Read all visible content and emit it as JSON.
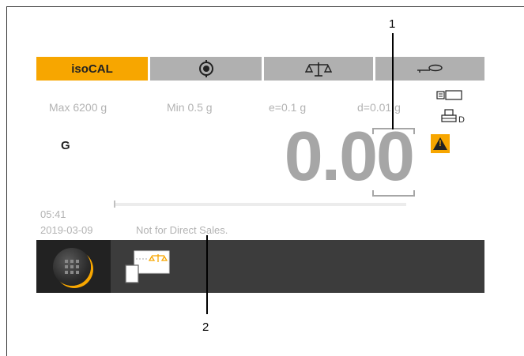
{
  "tabs": {
    "calibration_label": "isoCAL",
    "target_icon": "target-icon",
    "scale_icon": "balance-scale-icon",
    "key_icon": "key-icon"
  },
  "specs": {
    "max": "Max 6200 g",
    "min": "Min 0.5 g",
    "e": "e=0.1 g",
    "d": "d=0.01 g"
  },
  "weighing": {
    "mode": "G",
    "value": "0.00"
  },
  "status_icons": [
    "card-icon",
    "printer-icon",
    "warning-icon"
  ],
  "status_icon_text": {
    "printer_suffix": "D",
    "warning_symbol": "!"
  },
  "footer": {
    "time": "05:41",
    "date": "2019-03-09",
    "note": "Not for Direct Sales."
  },
  "taskbar": {
    "home_icon": "grid-menu-icon",
    "app_icon": "weighing-app-icon"
  },
  "callouts": {
    "one": "1",
    "two": "2"
  },
  "colors": {
    "accent": "#f7a600",
    "tab_gray": "#b0b0b0",
    "display_gray": "#a6a6a6",
    "taskbar": "#3c3c3c"
  }
}
